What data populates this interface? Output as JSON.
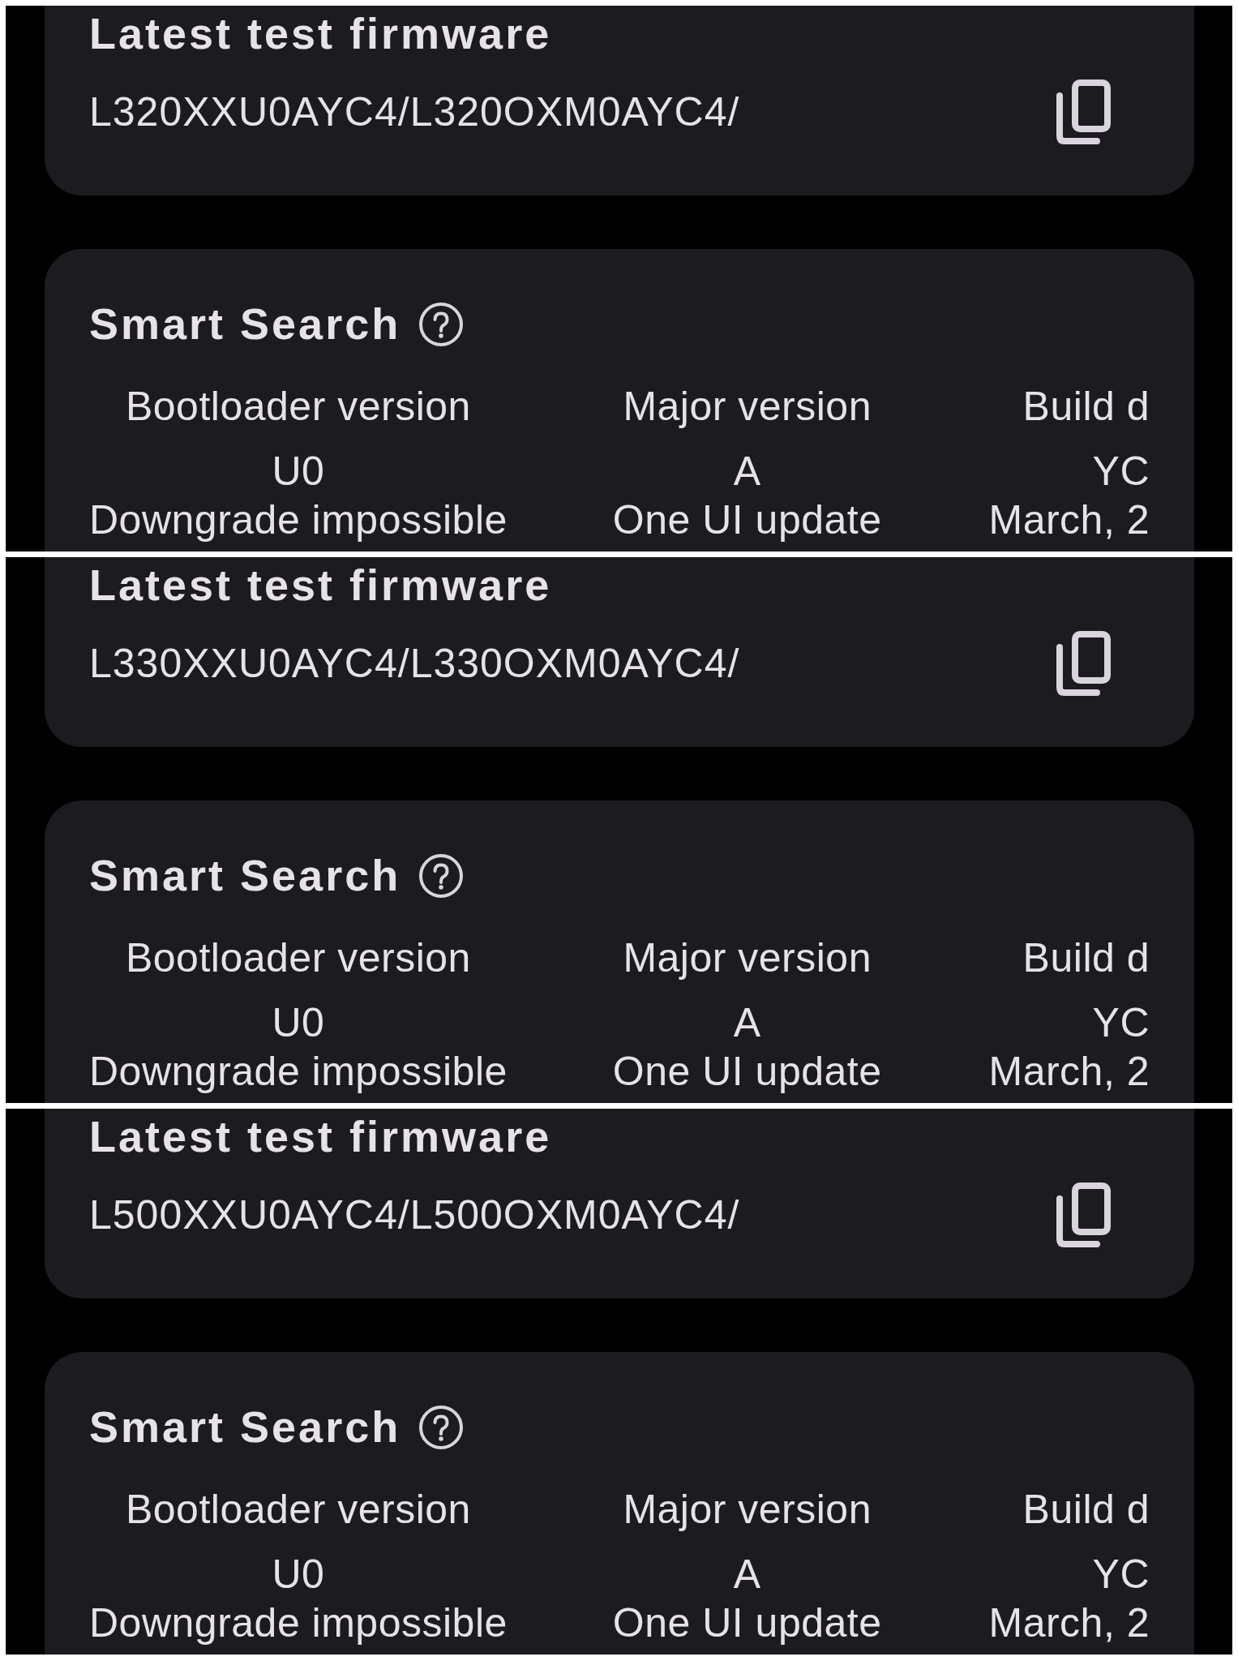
{
  "panels": [
    {
      "firmware_card": {
        "title": "Latest test firmware",
        "firmware": "L320XXU0AYC4/L320OXM0AYC4/"
      },
      "smart_search": {
        "title": "Smart Search",
        "columns": [
          {
            "header": "Bootloader version",
            "value": "U0",
            "note": "Downgrade impossible"
          },
          {
            "header": "Major version",
            "value": "A",
            "note": "One UI update"
          },
          {
            "header": "Build d",
            "value": "YC",
            "note": "March, 2"
          }
        ]
      }
    },
    {
      "firmware_card": {
        "title": "Latest test firmware",
        "firmware": "L330XXU0AYC4/L330OXM0AYC4/"
      },
      "smart_search": {
        "title": "Smart Search",
        "columns": [
          {
            "header": "Bootloader version",
            "value": "U0",
            "note": "Downgrade impossible"
          },
          {
            "header": "Major version",
            "value": "A",
            "note": "One UI update"
          },
          {
            "header": "Build d",
            "value": "YC",
            "note": "March, 2"
          }
        ]
      }
    },
    {
      "firmware_card": {
        "title": "Latest test firmware",
        "firmware": "L500XXU0AYC4/L500OXM0AYC4/"
      },
      "smart_search": {
        "title": "Smart Search",
        "columns": [
          {
            "header": "Bootloader version",
            "value": "U0",
            "note": "Downgrade impossible"
          },
          {
            "header": "Major version",
            "value": "A",
            "note": "One UI update"
          },
          {
            "header": "Build d",
            "value": "YC",
            "note": "March, 2"
          }
        ]
      }
    }
  ]
}
